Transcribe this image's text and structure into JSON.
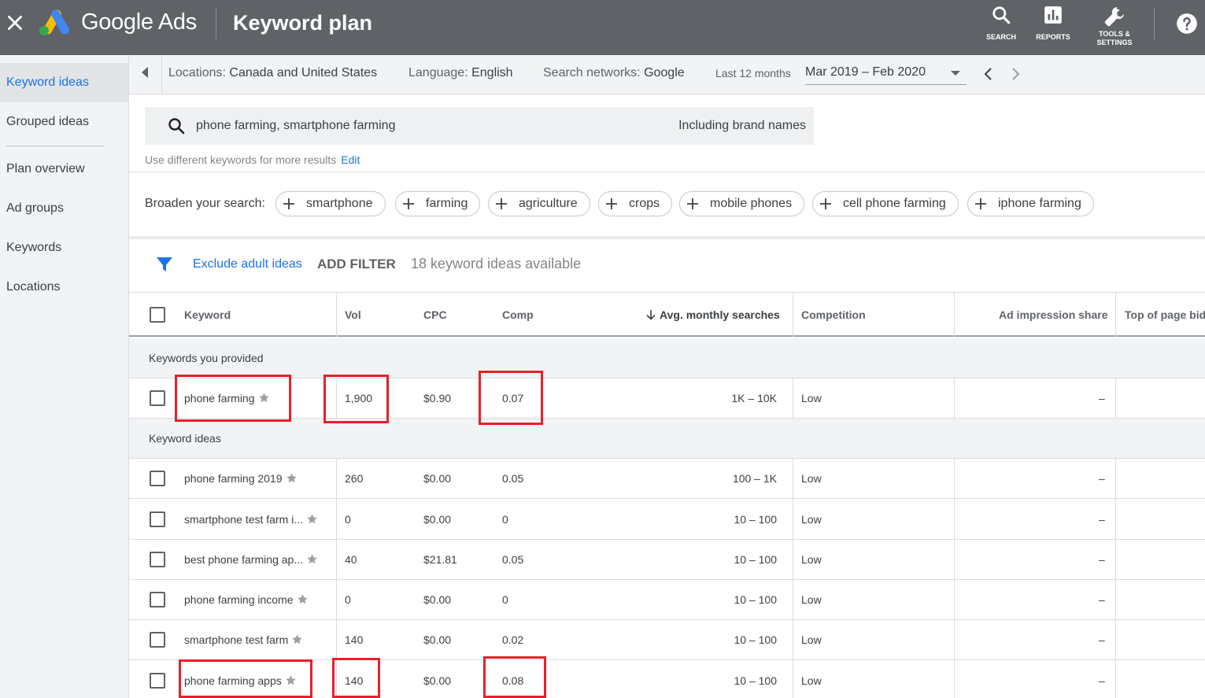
{
  "header": {
    "brand": "Google Ads",
    "title": "Keyword plan",
    "tools": [
      {
        "label": "SEARCH",
        "icon": "search-icon"
      },
      {
        "label": "REPORTS",
        "icon": "reports-icon"
      },
      {
        "label_line1": "TOOLS &",
        "label_line2": "SETTINGS",
        "icon": "wrench-icon"
      }
    ]
  },
  "sidebar": {
    "items": [
      {
        "label": "Keyword ideas",
        "active": true
      },
      {
        "label": "Grouped ideas"
      },
      {
        "label": "Plan overview"
      },
      {
        "label": "Ad groups"
      },
      {
        "label": "Keywords"
      },
      {
        "label": "Locations"
      }
    ]
  },
  "filters": {
    "locations_label": "Locations:",
    "locations_value": "Canada and United States",
    "language_label": "Language:",
    "language_value": "English",
    "networks_label": "Search networks:",
    "networks_value": "Google",
    "period_label": "Last 12 months",
    "period_value": "Mar 2019 – Feb 2020"
  },
  "search": {
    "query": "phone farming, smartphone farming",
    "brand_names": "Including brand names",
    "hint": "Use different keywords for more results",
    "edit": "Edit"
  },
  "broaden": {
    "label": "Broaden your search:",
    "chips": [
      "smartphone",
      "farming",
      "agriculture",
      "crops",
      "mobile phones",
      "cell phone farming",
      "iphone farming"
    ]
  },
  "filterbar": {
    "exclude": "Exclude adult ideas",
    "add_filter": "ADD FILTER",
    "available": "18 keyword ideas available"
  },
  "table": {
    "columns": {
      "keyword": "Keyword",
      "vol": "Vol",
      "cpc": "CPC",
      "comp": "Comp",
      "avg": "Avg. monthly searches",
      "competition": "Competition",
      "impression": "Ad impression share",
      "top_bid": "Top of page bid"
    },
    "group_provided": "Keywords you provided",
    "group_ideas": "Keyword ideas",
    "provided_rows": [
      {
        "keyword": "phone farming",
        "vol": "1,900",
        "cpc": "$0.90",
        "comp": "0.07",
        "avg": "1K – 10K",
        "competition": "Low",
        "impression": "–"
      }
    ],
    "idea_rows": [
      {
        "keyword": "phone farming 2019",
        "vol": "260",
        "cpc": "$0.00",
        "comp": "0.05",
        "avg": "100 – 1K",
        "competition": "Low",
        "impression": "–"
      },
      {
        "keyword": "smartphone test farm i...",
        "vol": "0",
        "cpc": "$0.00",
        "comp": "0",
        "avg": "10 – 100",
        "competition": "Low",
        "impression": "–"
      },
      {
        "keyword": "best phone farming ap...",
        "vol": "40",
        "cpc": "$21.81",
        "comp": "0.05",
        "avg": "10 – 100",
        "competition": "Low",
        "impression": "–"
      },
      {
        "keyword": "phone farming income",
        "vol": "0",
        "cpc": "$0.00",
        "comp": "0",
        "avg": "10 – 100",
        "competition": "Low",
        "impression": "–"
      },
      {
        "keyword": "smartphone test farm",
        "vol": "140",
        "cpc": "$0.00",
        "comp": "0.02",
        "avg": "10 – 100",
        "competition": "Low",
        "impression": "–"
      },
      {
        "keyword": "phone farming apps",
        "vol": "140",
        "cpc": "$0.00",
        "comp": "0.08",
        "avg": "10 – 100",
        "competition": "Low",
        "impression": "–"
      }
    ]
  },
  "colors": {
    "topbar": "#5f6368",
    "accent_blue": "#1a73e8",
    "highlight_red": "#e8202a"
  }
}
